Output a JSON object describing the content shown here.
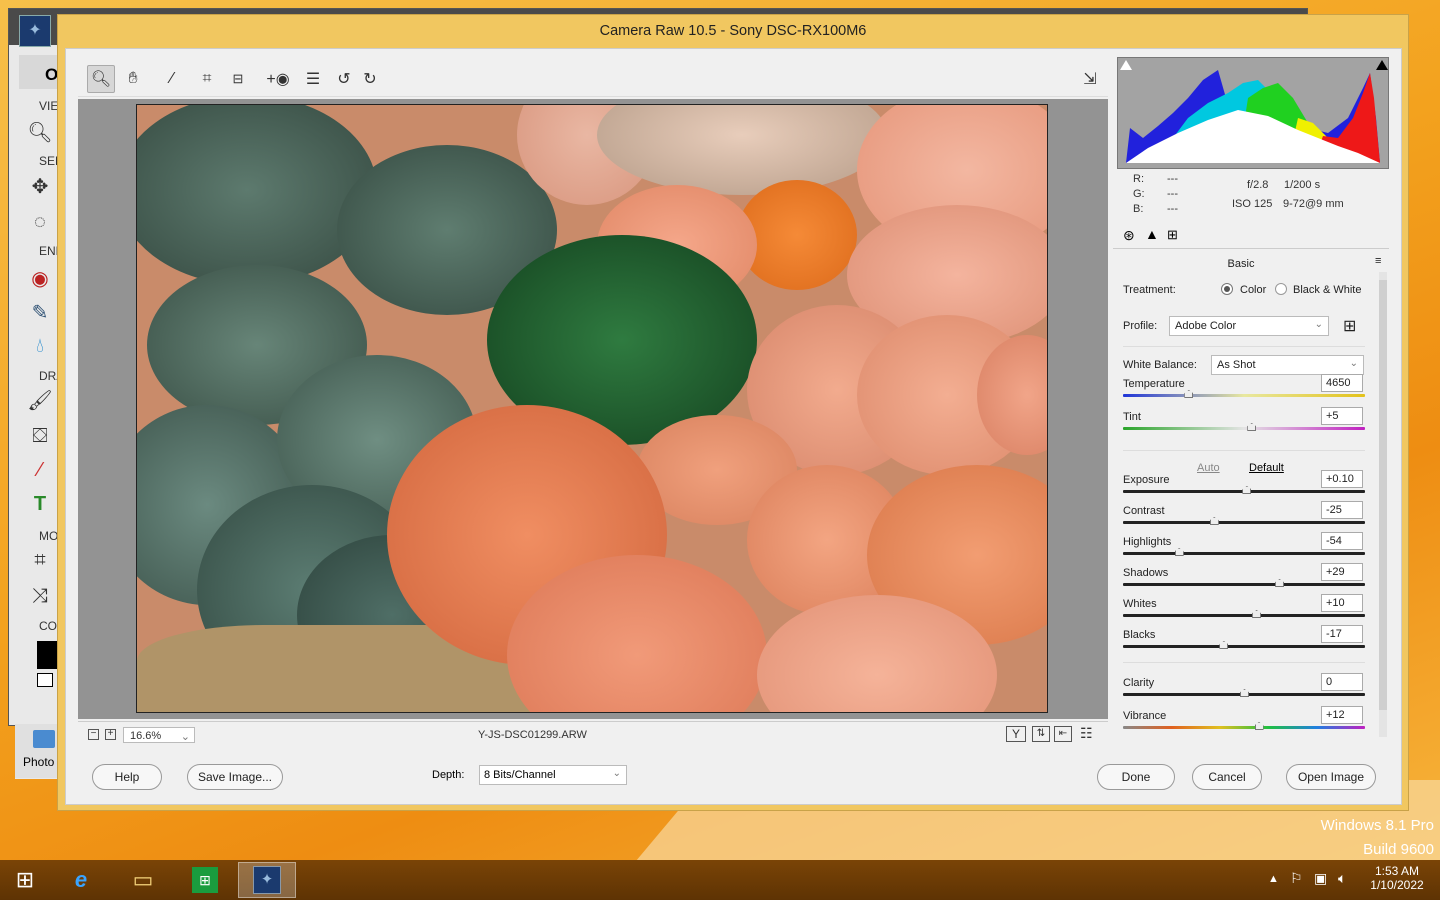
{
  "dialog": {
    "title": "Camera Raw 10.5  -  Sony DSC-RX100M6"
  },
  "host_app": {
    "title_abbrev": "Op",
    "sections": [
      "VIE",
      "SELE",
      "ENHA",
      "DRA",
      "MOD",
      "COL"
    ],
    "bottom_label": "Photo"
  },
  "toolbar": {
    "icons": [
      "zoom-tool-icon",
      "hand-tool-icon",
      "white-balance-tool-icon",
      "crop-tool-icon",
      "straighten-tool-icon",
      "red-eye-tool-icon",
      "preferences-icon",
      "rotate-left-icon",
      "rotate-right-icon",
      "fullscreen-icon"
    ]
  },
  "status": {
    "zoom_value": "16.6%",
    "filename": "Y-JS-DSC01299.ARW"
  },
  "readout": {
    "r_label": "R:",
    "g_label": "G:",
    "b_label": "B:",
    "r_value": "---",
    "g_value": "---",
    "b_value": "---",
    "aperture": "f/2.8",
    "shutter": "1/200 s",
    "iso": "ISO 125",
    "focal": "9-72@9 mm"
  },
  "panel": {
    "title": "Basic",
    "treatment_label": "Treatment:",
    "treatment_color": "Color",
    "treatment_bw": "Black & White",
    "treatment_selected": "Color",
    "profile_label": "Profile:",
    "profile_value": "Adobe Color",
    "wb_label": "White Balance:",
    "wb_value": "As Shot",
    "auto_link": "Auto",
    "default_link": "Default",
    "sliders": [
      {
        "label": "Temperature",
        "value": "4650",
        "pos": 0.27
      },
      {
        "label": "Tint",
        "value": "+5",
        "pos": 0.53
      },
      {
        "label": "Exposure",
        "value": "+0.10",
        "pos": 0.51
      },
      {
        "label": "Contrast",
        "value": "-25",
        "pos": 0.375
      },
      {
        "label": "Highlights",
        "value": "-54",
        "pos": 0.23
      },
      {
        "label": "Shadows",
        "value": "+29",
        "pos": 0.645
      },
      {
        "label": "Whites",
        "value": "+10",
        "pos": 0.55
      },
      {
        "label": "Blacks",
        "value": "-17",
        "pos": 0.415
      },
      {
        "label": "Clarity",
        "value": "0",
        "pos": 0.5
      },
      {
        "label": "Vibrance",
        "value": "+12",
        "pos": 0.56
      }
    ]
  },
  "bottom": {
    "help_label": "Help",
    "save_label": "Save Image...",
    "depth_label": "Depth:",
    "depth_value": "8 Bits/Channel",
    "done_label": "Done",
    "cancel_label": "Cancel",
    "open_label": "Open Image"
  },
  "watermark": {
    "line1": "Windows 8.1 Pro",
    "line2": "Build 9600"
  },
  "taskbar": {
    "time": "1:53 AM",
    "date": "1/10/2022"
  }
}
